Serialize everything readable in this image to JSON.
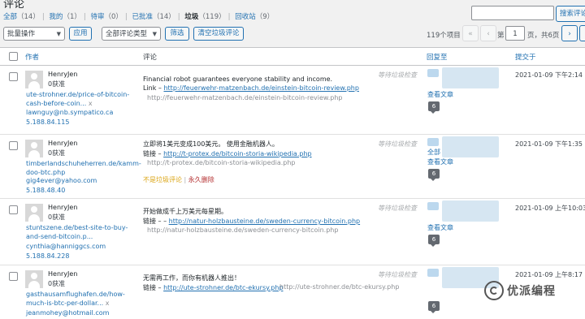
{
  "page": {
    "title": "评论"
  },
  "filters": {
    "all": "全部",
    "all_count": "（14）",
    "mine": "我的",
    "mine_count": "（1）",
    "pending": "待审",
    "pending_count": "（0）",
    "approved": "已批准",
    "approved_count": "（14）",
    "spam": "垃圾",
    "spam_count": "（119）",
    "trash": "回收站",
    "trash_count": "（9）"
  },
  "search": {
    "button": "搜索评论",
    "value": ""
  },
  "toolbar": {
    "bulk_action": "批量操作",
    "apply": "应用",
    "type_filter": "全部评论类型",
    "filter": "筛选",
    "empty_spam": "清空垃圾评论"
  },
  "pagination": {
    "items": "119个项目",
    "first": "«",
    "prev": "‹",
    "page_prefix": "第",
    "current": "1",
    "of": "页，共6页",
    "next": "›",
    "last": "»"
  },
  "table": {
    "headers": {
      "author": "作者",
      "comment": "评论",
      "in_response_to": "回复至",
      "submitted": "提交于"
    }
  },
  "comments": [
    {
      "author_name": "HenryJen",
      "author_status": "0获准",
      "author_url": "ute-strohner.de/price-of-bitcoin-cash-before-coin...",
      "author_email": "lawnguy@nb.sympatico.ca",
      "author_ip": "5.188.84.115",
      "text": "Financial robot guarantees everyone stability and income.",
      "link_label": "Link – ",
      "link_url": "http://feuerwehr-matzenbach.de/einstein-bitcoin-review.php",
      "plain_url": "http://feuerwehr-matzenbach.de/einstein-bitcoin-review.php",
      "pending": "等待垃圾检查",
      "response_view": "查看文章",
      "count": "6",
      "date": "2021-01-09 下午2:14"
    },
    {
      "author_name": "HenryJen",
      "author_status": "0获准",
      "author_url": "timberlandschuheherren.de/kamm-doo-btc.php",
      "author_email": "gig4ever@yahoo.com",
      "author_ip": "5.188.48.40",
      "text": "立即将1美元变成100美元。 使用金融机器人。",
      "link_label": "链接 – ",
      "link_url": "http://t-protex.de/bitcoin-storia-wikipedia.php",
      "plain_url": "http://t-protex.de/bitcoin-storia-wikipedia.php",
      "pending": "等待垃圾检查",
      "not_spam": "不是垃圾评论",
      "delete": "永久删除",
      "response_view": "查看文章",
      "count": "6",
      "date": "2021-01-09 下午1:35"
    },
    {
      "author_name": "HenryJen",
      "author_status": "0获准",
      "author_url": "stuntszene.de/best-site-to-buy-and-send-bitcoin.p...",
      "author_email": "cynthia@hanniggcs.com",
      "author_ip": "5.188.84.228",
      "text": "开始做成千上万美元每星期。",
      "link_label": "链接 – – ",
      "link_url": "http://natur-holzbausteine.de/sweden-currency-bitcoin.php",
      "plain_url": "http://natur-holzbausteine.de/sweden-currency-bitcoin.php",
      "pending": "等待垃圾检查",
      "response_view": "查看文章",
      "count": "6",
      "date": "2021-01-09 上午10:03"
    },
    {
      "author_name": "HenryJen",
      "author_status": "0获准",
      "author_url": "gasthausamflughafen.de/how-much-is-btc-per-dollar...",
      "author_email": "jeanmohey@hotmail.com",
      "author_ip": "",
      "text": "无需再工作，而你有机器人推出！",
      "link_label": "链接 – ",
      "link_url": "http://ute-strohner.de/btc-ekursy.php",
      "plain_url": "http://ute-strohner.de/btc-ekursy.php",
      "pending": "等待垃圾检查",
      "response_view": "",
      "count": "6",
      "date": "2021-01-09 上午8:17"
    }
  ],
  "watermark": {
    "text": "优派编程"
  }
}
